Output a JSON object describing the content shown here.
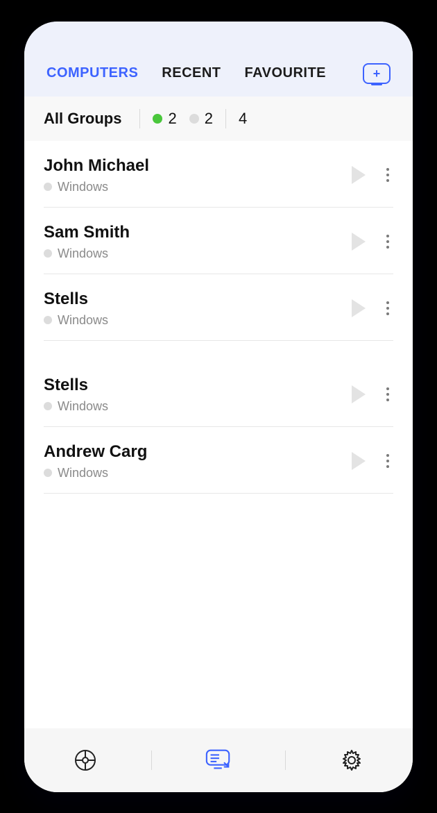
{
  "tabs": {
    "computers": "COMPUTERS",
    "recent": "RECENT",
    "favourite": "FAVOURITE"
  },
  "groups": {
    "label": "All Groups",
    "online_count": "2",
    "offline_count": "2",
    "total_count": "4"
  },
  "rows": [
    {
      "name": "John Michael",
      "os": "Windows"
    },
    {
      "name": "Sam Smith",
      "os": "Windows"
    },
    {
      "name": "Stells",
      "os": "Windows"
    },
    {
      "name": "Stells",
      "os": "Windows"
    },
    {
      "name": "Andrew Carg",
      "os": "Windows"
    }
  ],
  "colors": {
    "accent": "#3d63ff",
    "online": "#4ac73c",
    "offline": "#dcdcdc"
  }
}
